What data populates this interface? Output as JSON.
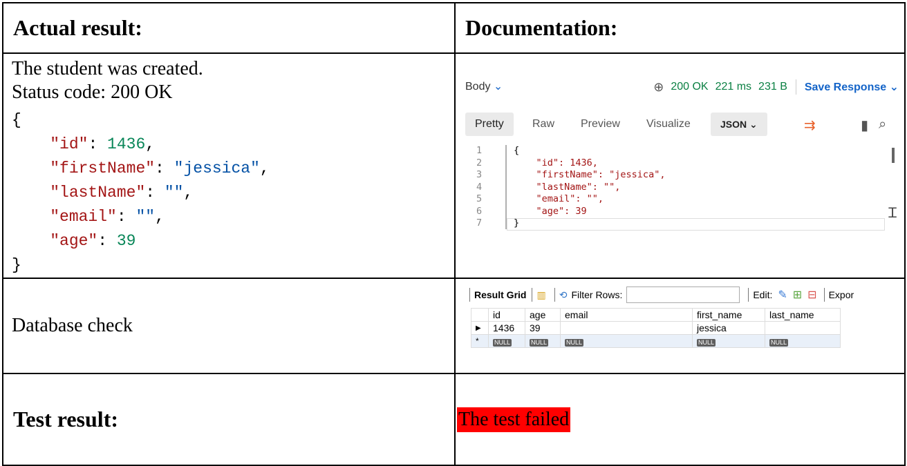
{
  "headers": {
    "actual": "Actual result:",
    "documentation": "Documentation:"
  },
  "actual": {
    "created": "The student was created.",
    "status": "Status code: 200 OK",
    "json": {
      "open": "{",
      "close": "}",
      "id_key": "\"id\"",
      "id_val": "1436",
      "first_key": "\"firstName\"",
      "first_val": "\"jessica\"",
      "last_key": "\"lastName\"",
      "last_val": "\"\"",
      "email_key": "\"email\"",
      "email_val": "\"\"",
      "age_key": "\"age\"",
      "age_val": "39"
    }
  },
  "postman": {
    "body_label": "Body",
    "status": "200 OK",
    "time": "221 ms",
    "size": "231 B",
    "save": "Save Response",
    "tabs": [
      "Pretty",
      "Raw",
      "Preview",
      "Visualize"
    ],
    "format": "JSON",
    "line_numbers": [
      "1",
      "2",
      "3",
      "4",
      "5",
      "6",
      "7"
    ],
    "lines": [
      "{",
      "    \"id\": 1436,",
      "    \"firstName\": \"jessica\",",
      "    \"lastName\": \"\",",
      "    \"email\": \"\",",
      "    \"age\": 39",
      "}"
    ]
  },
  "db": {
    "label": "Database check",
    "toolbar": {
      "title": "Result Grid",
      "filter": "Filter Rows:",
      "edit": "Edit:",
      "export": "Expor"
    },
    "columns": [
      "id",
      "age",
      "email",
      "first_name",
      "last_name"
    ],
    "row": [
      "1436",
      "39",
      "",
      "jessica",
      ""
    ],
    "null_label": "NULL"
  },
  "test": {
    "label": "Test result:",
    "value": "The test failed",
    "fail_color": "#ff0000"
  }
}
